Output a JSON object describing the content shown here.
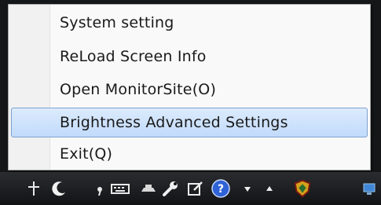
{
  "context_menu": {
    "items": [
      {
        "label": "System setting",
        "selected": false
      },
      {
        "label": "ReLoad Screen Info",
        "selected": false
      },
      {
        "label": "Open MonitorSite(O)",
        "selected": false
      },
      {
        "label": "Brightness Advanced Settings",
        "selected": true
      },
      {
        "label": "Exit(Q)",
        "selected": false
      }
    ]
  },
  "taskbar": {
    "tray_icons": [
      "pin-icon",
      "moon-icon",
      "comma-icon",
      "keyboard-icon",
      "hat-icon",
      "wrench-icon",
      "edit-icon",
      "help-icon",
      "arrow-down-icon",
      "arrow-up-icon",
      "shield-icon",
      "network-icon"
    ]
  },
  "colors": {
    "menu_background": "#f9f9f9",
    "selection_fill": "#c1dbfc",
    "selection_border": "#7da2ce",
    "taskbar": "#121315"
  }
}
